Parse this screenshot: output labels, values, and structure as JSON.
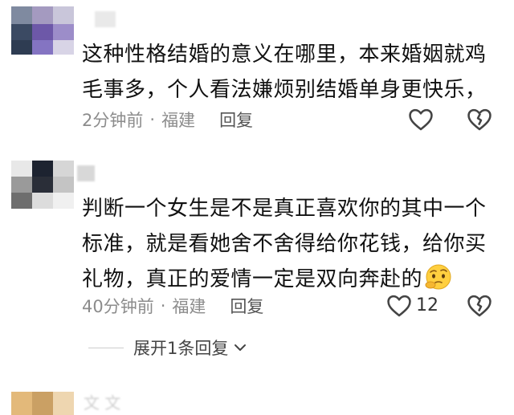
{
  "comments": [
    {
      "text": "这种性格结婚的意义在哪里，本来婚姻就鸡毛事多，个人看法嫌烦别结婚单身更快乐，",
      "time": "2分钟前",
      "location": "福建",
      "reply_label": "回复",
      "like_count": ""
    },
    {
      "text": "判断一个女生是不是真正喜欢你的其中一个标准，就是看她舍不舍得给你花钱，给你买礼物，真正的爱情一定是双向奔赴的",
      "time": "40分钟前",
      "location": "福建",
      "reply_label": "回复",
      "like_count": "12",
      "emoji": "thinking-face-emoji"
    }
  ],
  "expand_replies": {
    "label": "展开1条回复"
  },
  "separator": "·",
  "icons": {
    "like": "heart-outline-icon",
    "dislike": "broken-heart-icon",
    "expand": "chevron-down-icon"
  },
  "partial_comment": {
    "username_partial": "文 文"
  }
}
